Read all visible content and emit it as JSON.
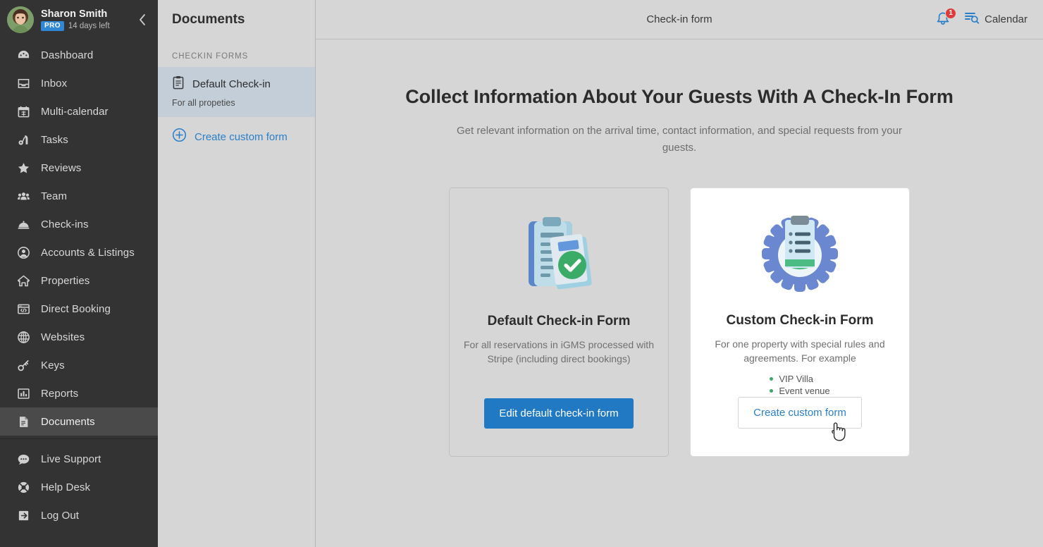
{
  "sidebar": {
    "user": {
      "name": "Sharon Smith",
      "plan_badge": "PRO",
      "trial_text": "14 days left",
      "avatar_icon": "user-avatar-photo",
      "collapse_icon": "chevron-left-icon"
    },
    "items": [
      {
        "label": "Dashboard",
        "icon": "dashboard-gauge-icon",
        "active": false
      },
      {
        "label": "Inbox",
        "icon": "inbox-tray-icon",
        "active": false
      },
      {
        "label": "Multi-calendar",
        "icon": "calendar-grid-icon",
        "active": false
      },
      {
        "label": "Tasks",
        "icon": "vacuum-tasks-icon",
        "active": false
      },
      {
        "label": "Reviews",
        "icon": "star-icon",
        "active": false
      },
      {
        "label": "Team",
        "icon": "people-group-icon",
        "active": false
      },
      {
        "label": "Check-ins",
        "icon": "service-bell-icon",
        "active": false
      },
      {
        "label": "Accounts & Listings",
        "icon": "user-circle-icon",
        "active": false
      },
      {
        "label": "Properties",
        "icon": "house-icon",
        "active": false
      },
      {
        "label": "Direct Booking",
        "icon": "browser-code-icon",
        "active": false
      },
      {
        "label": "Websites",
        "icon": "globe-icon",
        "active": false
      },
      {
        "label": "Keys",
        "icon": "key-icon",
        "active": false
      },
      {
        "label": "Reports",
        "icon": "bar-chart-icon",
        "active": false
      },
      {
        "label": "Documents",
        "icon": "document-icon",
        "active": true
      }
    ],
    "bottom_items": [
      {
        "label": "Live Support",
        "icon": "chat-bubble-icon"
      },
      {
        "label": "Help Desk",
        "icon": "lifebuoy-icon"
      },
      {
        "label": "Log Out",
        "icon": "logout-arrow-icon"
      }
    ]
  },
  "docpanel": {
    "title": "Documents",
    "section_label": "CHECKIN FORMS",
    "forms": [
      {
        "name": "Default Check-in",
        "sub": "For all propeties",
        "icon": "clipboard-icon",
        "selected": true
      }
    ],
    "create_link": {
      "label": "Create custom form",
      "icon": "plus-circle-icon"
    }
  },
  "topbar": {
    "title": "Check-in form",
    "notifications": {
      "icon": "bell-icon",
      "count": "1"
    },
    "calendar": {
      "icon": "calendar-search-icon",
      "label": "Calendar"
    }
  },
  "main": {
    "headline": "Collect Information About Your Guests With A Check-In Form",
    "subhead": "Get relevant information on the arrival time, contact information, and special requests from your guests.",
    "cards": [
      {
        "id": "default-check-in-form",
        "illustration": "clipboard-check-illustration",
        "title": "Default Check-in Form",
        "description": "For all reservations in iGMS processed with Stripe (including direct bookings)",
        "bullets": [],
        "button_label": "Edit default check-in form",
        "button_style": "primary"
      },
      {
        "id": "custom-check-in-form",
        "illustration": "gear-clipboard-illustration",
        "title": "Custom Check-in Form",
        "description": "For one property with special rules and agreements. For example",
        "bullets": [
          "VIP Villa",
          "Event venue"
        ],
        "button_label": "Create custom form",
        "button_style": "outline"
      }
    ]
  },
  "cursor": {
    "type": "pointing-hand-cursor"
  },
  "colors": {
    "sidebar_bg": "#333333",
    "sidebar_active": "#4a4a4a",
    "page_bg": "#d6d6d6",
    "accent_blue": "#2179c4",
    "link_blue": "#2a7fc9",
    "badge_red": "#e03b3b",
    "bullet_green": "#3ca86a",
    "pro_badge_blue": "#2f87d6",
    "selected_item_bg": "#c3ced8"
  }
}
